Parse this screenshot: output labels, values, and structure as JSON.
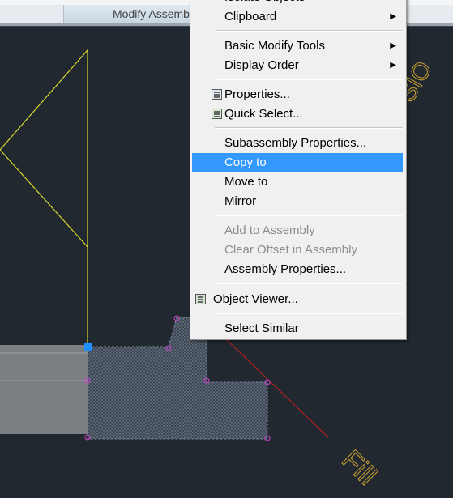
{
  "ribbon": {
    "panel_label": "Modify Assembly"
  },
  "menu": {
    "items": [
      {
        "label": "Isolate Objects",
        "submenu": true
      },
      {
        "label": "Clipboard",
        "submenu": true
      },
      {
        "label": "Basic Modify Tools",
        "submenu": true
      },
      {
        "label": "Display Order",
        "submenu": true
      },
      {
        "label": "Properties...",
        "icon": "properties-icon"
      },
      {
        "label": "Quick Select...",
        "icon": "quick-select-icon"
      },
      {
        "label": "Subassembly Properties..."
      },
      {
        "label": "Copy to",
        "highlighted": true
      },
      {
        "label": "Move to"
      },
      {
        "label": "Mirror"
      },
      {
        "label": "Add to Assembly",
        "disabled": true
      },
      {
        "label": "Clear Offset in Assembly",
        "disabled": true
      },
      {
        "label": "Assembly Properties..."
      },
      {
        "label": "Object Viewer...",
        "icon": "object-viewer-icon"
      },
      {
        "label": "Select Similar"
      }
    ],
    "submenu_arrow": "▶"
  },
  "canvas": {
    "label_top_right": "SIO",
    "label_bottom_right": "Fill"
  },
  "colors": {
    "background": "#212830",
    "highlight": "#3399ff",
    "cad_yellow": "#d8d82a",
    "cad_red": "#cc1f1f",
    "grip_magenta": "#d040d0",
    "grip_blue": "#1e90ff",
    "label_orange": "#c8a030"
  }
}
